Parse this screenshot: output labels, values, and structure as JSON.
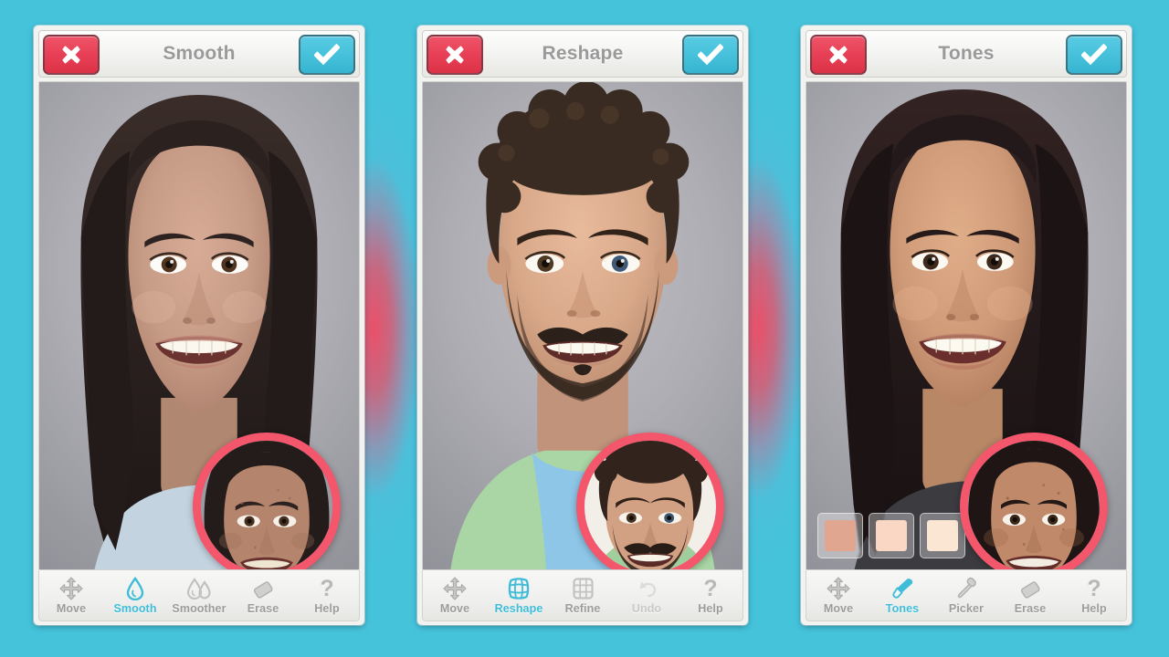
{
  "app": {
    "background_color": "#45c3db",
    "accent_color": "#3fbcd8",
    "cancel_color": "#e63e54",
    "confirm_color": "#45c0da",
    "loupe_ring_color": "#f4566c",
    "glow_color": "#f8465f"
  },
  "panels": [
    {
      "id": "smooth",
      "header": {
        "title": "Smooth",
        "cancel_icon": "close-x-icon",
        "confirm_icon": "checkmark-icon"
      },
      "photo": {
        "subject": "woman-portrait-smoothed",
        "skin": "#c49a86",
        "skin_shadow": "#a87b68",
        "hair": "#2b2220",
        "hair_light": "#4a3a33",
        "clothing": "#b9cfdd",
        "backdrop": "#b0b0b6",
        "loupe": {
          "label": "before-preview",
          "ring_color": "#f4566c",
          "skin": "#b4846c",
          "hair": "#241c1a"
        }
      },
      "tools": [
        {
          "label": "Move",
          "icon": "move-arrows-icon",
          "state": "normal"
        },
        {
          "label": "Smooth",
          "icon": "droplet-icon",
          "state": "active"
        },
        {
          "label": "Smoother",
          "icon": "double-droplet-icon",
          "state": "normal"
        },
        {
          "label": "Erase",
          "icon": "eraser-icon",
          "state": "normal"
        },
        {
          "label": "Help",
          "icon": "question-mark-icon",
          "state": "normal"
        }
      ],
      "swatches": []
    },
    {
      "id": "reshape",
      "header": {
        "title": "Reshape",
        "cancel_icon": "close-x-icon",
        "confirm_icon": "checkmark-icon"
      },
      "photo": {
        "subject": "man-portrait-reshaped",
        "skin": "#d8a889",
        "skin_shadow": "#b5846a",
        "hair": "#3a2b22",
        "hair_light": "#5e4634",
        "clothing": "#8ec6e8",
        "jacket": "#a9d6a4",
        "backdrop": "#a9a9b0",
        "loupe": {
          "label": "before-preview",
          "ring_color": "#f4566c",
          "skin": "#d2a184",
          "hair": "#32241c"
        }
      },
      "tools": [
        {
          "label": "Move",
          "icon": "move-arrows-icon",
          "state": "normal"
        },
        {
          "label": "Reshape",
          "icon": "warp-mesh-icon",
          "state": "active"
        },
        {
          "label": "Refine",
          "icon": "grid-icon",
          "state": "normal"
        },
        {
          "label": "Undo",
          "icon": "undo-icon",
          "state": "disabled"
        },
        {
          "label": "Help",
          "icon": "question-mark-icon",
          "state": "normal"
        }
      ],
      "swatches": []
    },
    {
      "id": "tones",
      "header": {
        "title": "Tones",
        "cancel_icon": "close-x-icon",
        "confirm_icon": "checkmark-icon"
      },
      "photo": {
        "subject": "woman-portrait-tones",
        "skin": "#cf9a78",
        "skin_shadow": "#ab7859",
        "hair": "#23191a",
        "hair_light": "#463230",
        "clothing": "#3b3b40",
        "backdrop": "#b4b4b9",
        "loupe": {
          "label": "before-preview",
          "ring_color": "#f4566c",
          "skin": "#c08a6a",
          "hair": "#1e1514"
        }
      },
      "tools": [
        {
          "label": "Move",
          "icon": "move-arrows-icon",
          "state": "normal"
        },
        {
          "label": "Tones",
          "icon": "brush-icon",
          "state": "active"
        },
        {
          "label": "Picker",
          "icon": "eyedropper-icon",
          "state": "normal"
        },
        {
          "label": "Erase",
          "icon": "eraser-icon",
          "state": "normal"
        },
        {
          "label": "Help",
          "icon": "question-mark-icon",
          "state": "normal"
        }
      ],
      "swatches": [
        {
          "name": "skin-tone-medium",
          "color": "#e0a68f"
        },
        {
          "name": "skin-tone-light",
          "color": "#fad6c4"
        },
        {
          "name": "skin-tone-pale",
          "color": "#fbe6d4"
        }
      ]
    }
  ]
}
